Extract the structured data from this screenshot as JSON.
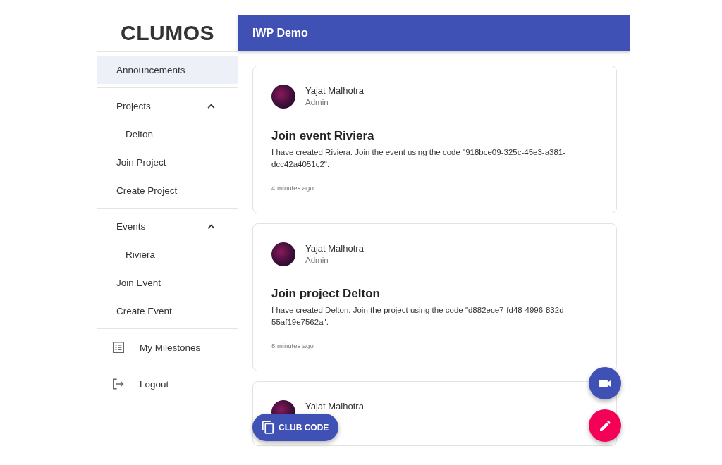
{
  "logo": {
    "text": "CLUMOS"
  },
  "app_bar": {
    "title": "IWP Demo"
  },
  "sidebar": {
    "sections": [
      {
        "items": [
          {
            "kind": "link",
            "label": "Announcements",
            "selected": true
          }
        ]
      },
      {
        "items": [
          {
            "kind": "group",
            "label": "Projects",
            "expanded": true,
            "children": [
              {
                "kind": "link",
                "label": "Delton",
                "selected": false
              }
            ]
          },
          {
            "kind": "link",
            "label": "Join Project",
            "selected": false
          },
          {
            "kind": "link",
            "label": "Create Project",
            "selected": false
          }
        ]
      },
      {
        "items": [
          {
            "kind": "group",
            "label": "Events",
            "expanded": true,
            "children": [
              {
                "kind": "link",
                "label": "Riviera",
                "selected": false
              }
            ]
          },
          {
            "kind": "link",
            "label": "Join Event",
            "selected": false
          },
          {
            "kind": "link",
            "label": "Create Event",
            "selected": false
          }
        ]
      },
      {
        "items": [
          {
            "kind": "icon_link",
            "label": "My Milestones",
            "selected": false
          },
          {
            "kind": "icon_link",
            "label": "Logout",
            "selected": false
          }
        ]
      }
    ]
  },
  "posts": [
    {
      "author": "Yajat Malhotra",
      "role": "Admin",
      "title": "Join event Riviera",
      "body": "I have created Riviera. Join the event using the code \"918bce09-325c-45e3-a381-dcc42a4051c2\".",
      "time": "4 minutes ago"
    },
    {
      "author": "Yajat Malhotra",
      "role": "Admin",
      "title": "Join project Delton",
      "body": "I have created Delton. Join the project using the code \"d882ece7-fd48-4996-832d-55af19e7562a\".",
      "time": "8 minutes ago"
    },
    {
      "author": "Yajat Malhotra"
    }
  ],
  "club_code_button": {
    "label": "CLUB CODE"
  }
}
